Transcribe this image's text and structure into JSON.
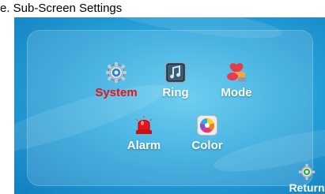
{
  "caption": "e. Sub-Screen Settings",
  "menu": {
    "system": "System",
    "ring": "Ring",
    "mode": "Mode",
    "alarm": "Alarm",
    "color": "Color"
  },
  "return_label": "Return",
  "selected": "System",
  "colors": {
    "selected_label": "#e8121a",
    "label": "#ffffff",
    "background": "#2aa6dc"
  }
}
